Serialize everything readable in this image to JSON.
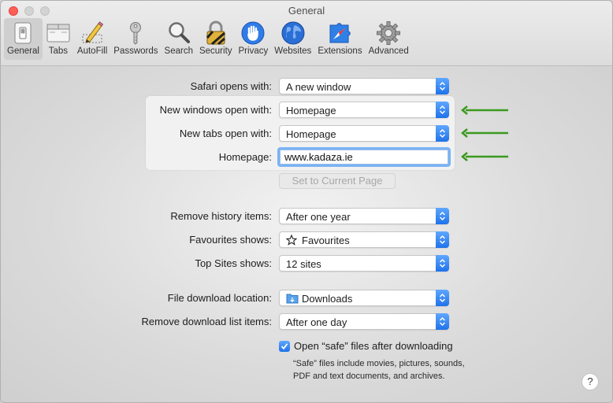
{
  "window": {
    "title": "General"
  },
  "tabs": [
    {
      "label": "General",
      "icon": "general-switch-icon",
      "selected": true
    },
    {
      "label": "Tabs",
      "icon": "tabs-icon"
    },
    {
      "label": "AutoFill",
      "icon": "pencil-form-icon"
    },
    {
      "label": "Passwords",
      "icon": "key-icon"
    },
    {
      "label": "Search",
      "icon": "magnifier-icon"
    },
    {
      "label": "Security",
      "icon": "padlock-icon"
    },
    {
      "label": "Privacy",
      "icon": "hand-icon"
    },
    {
      "label": "Websites",
      "icon": "globe-icon"
    },
    {
      "label": "Extensions",
      "icon": "puzzle-compass-icon"
    },
    {
      "label": "Advanced",
      "icon": "gear-icon"
    }
  ],
  "settings": {
    "safari_opens_with": {
      "label": "Safari opens with:",
      "value": "A new window"
    },
    "new_windows": {
      "label": "New windows open with:",
      "value": "Homepage"
    },
    "new_tabs": {
      "label": "New tabs open with:",
      "value": "Homepage"
    },
    "homepage": {
      "label": "Homepage:",
      "value": "www.kadaza.ie"
    },
    "set_current_page": {
      "label": "Set to Current Page"
    },
    "remove_history": {
      "label": "Remove history items:",
      "value": "After one year"
    },
    "favourites_shows": {
      "label": "Favourites shows:",
      "value": "Favourites"
    },
    "top_sites_shows": {
      "label": "Top Sites shows:",
      "value": "12 sites"
    },
    "download_location": {
      "label": "File download location:",
      "value": "Downloads"
    },
    "remove_download_list": {
      "label": "Remove download list items:",
      "value": "After one day"
    },
    "open_safe_files": {
      "label": "Open “safe” files after downloading",
      "checked": true,
      "note": "“Safe” files include movies, pictures, sounds, PDF and text documents, and archives."
    }
  },
  "help_label": "?",
  "colors": {
    "accent": "#1f72ea",
    "annotation_arrow": "#3a9a1e",
    "close": "#fe5f57"
  }
}
